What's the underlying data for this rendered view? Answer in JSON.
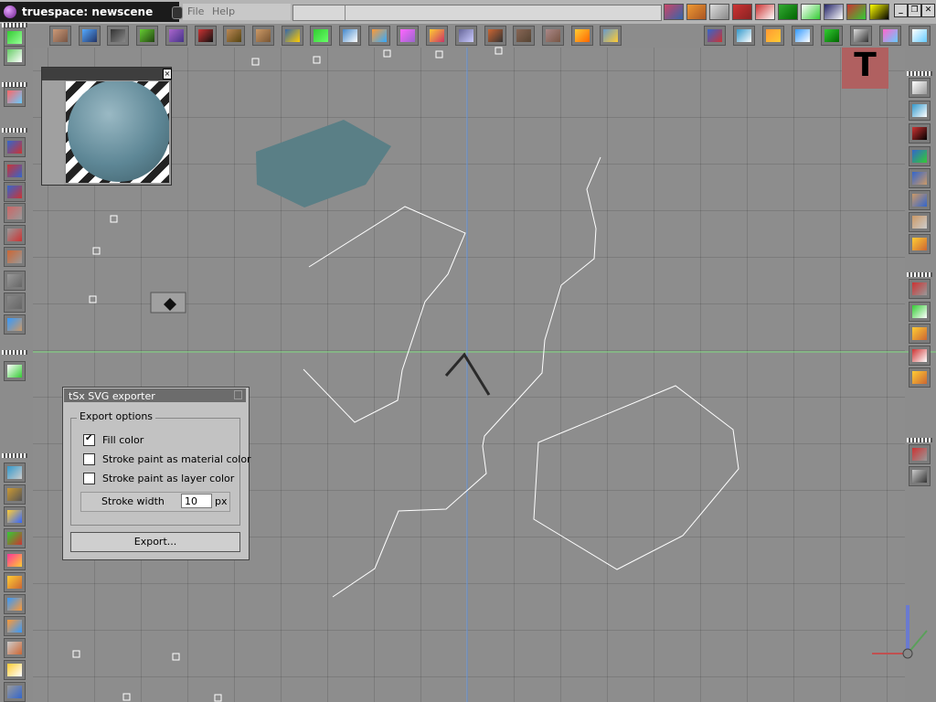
{
  "window": {
    "title": "truespace: newscene"
  },
  "menu": {
    "items": [
      "File",
      "Help"
    ]
  },
  "window_controls": {
    "minimize": "_",
    "restore": "❐",
    "close": "✕"
  },
  "top_right_button": {
    "label": "T"
  },
  "dialog": {
    "title": "tSx SVG exporter",
    "close_label": "×",
    "group_label": "Export options",
    "options": [
      {
        "label": "Fill color",
        "checked": true
      },
      {
        "label": "Stroke paint as material color",
        "checked": false
      },
      {
        "label": "Stroke paint as layer color",
        "checked": false
      }
    ],
    "stroke_width_label": "Stroke width",
    "stroke_width_value": "10",
    "stroke_width_unit": "px",
    "export_button": "Export..."
  },
  "colors": {
    "object_fill": "#5a7f86",
    "green_axis": "#7fdc7f",
    "blue_axis": "#6f9de0",
    "line_color": "#ffffff"
  }
}
